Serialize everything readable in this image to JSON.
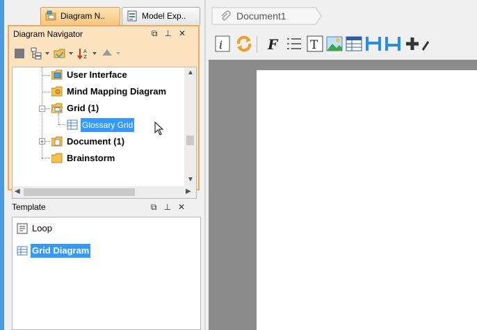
{
  "tabs": [
    {
      "label": "Diagram N..",
      "icon": "diagram-navigator-icon"
    },
    {
      "label": "Model Exp..",
      "icon": "model-explorer-icon"
    }
  ],
  "navigator": {
    "title": "Diagram Navigator",
    "controls": [
      "restore",
      "pin",
      "close"
    ],
    "tree": [
      {
        "label": "User Interface",
        "icon": "user-interface-folder-icon"
      },
      {
        "label": "Mind Mapping Diagram",
        "icon": "mind-mapping-folder-icon"
      },
      {
        "label": "Grid (1)",
        "icon": "grid-folder-open-icon",
        "expanded": true
      },
      {
        "label": "Glossary Grid",
        "icon": "glossary-grid-icon",
        "selected": true
      },
      {
        "label": "Document (1)",
        "icon": "document-folder-icon",
        "expanded": false
      },
      {
        "label": "Brainstorm",
        "icon": "brainstorm-folder-icon"
      }
    ]
  },
  "template": {
    "title": "Template",
    "items": [
      {
        "label": "Loop",
        "icon": "loop-icon"
      },
      {
        "label": "Grid Diagram",
        "icon": "grid-diagram-icon",
        "selected": true
      }
    ]
  },
  "document": {
    "tab_label": "Document1"
  },
  "colors": {
    "accent_bar": "#4d9be0",
    "nav_border": "#f0a95a",
    "nav_fill": "#fde3c0",
    "selection": "#3399ff",
    "canvas": "#8c8c8c"
  }
}
